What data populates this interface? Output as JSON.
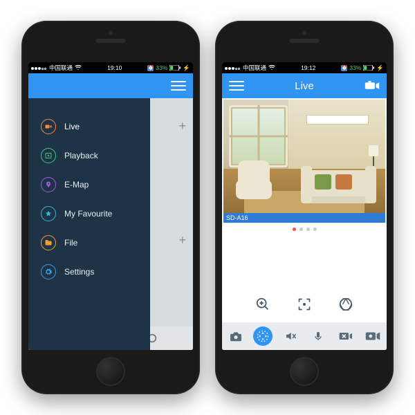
{
  "status": {
    "carrier": "中国联通",
    "time_left": "19:10",
    "time_right": "19:12",
    "battery": "33%"
  },
  "nav": {
    "title": "Live"
  },
  "menu": {
    "items": [
      {
        "label": "Live",
        "icon": "camera",
        "color": "#ff8a3d",
        "active": true
      },
      {
        "label": "Playback",
        "icon": "playback",
        "color": "#3ec97a",
        "active": false
      },
      {
        "label": "E-Map",
        "icon": "emap",
        "color": "#a05bea",
        "active": false
      },
      {
        "label": "My Favourite",
        "icon": "star",
        "color": "#2fb8d6",
        "active": false
      },
      {
        "label": "File",
        "icon": "file",
        "color": "#f0a030",
        "active": false
      },
      {
        "label": "Settings",
        "icon": "gear",
        "color": "#3a9de8",
        "active": false
      }
    ]
  },
  "camera": {
    "label": "SD-A16",
    "page_index": 0,
    "page_count": 4
  }
}
